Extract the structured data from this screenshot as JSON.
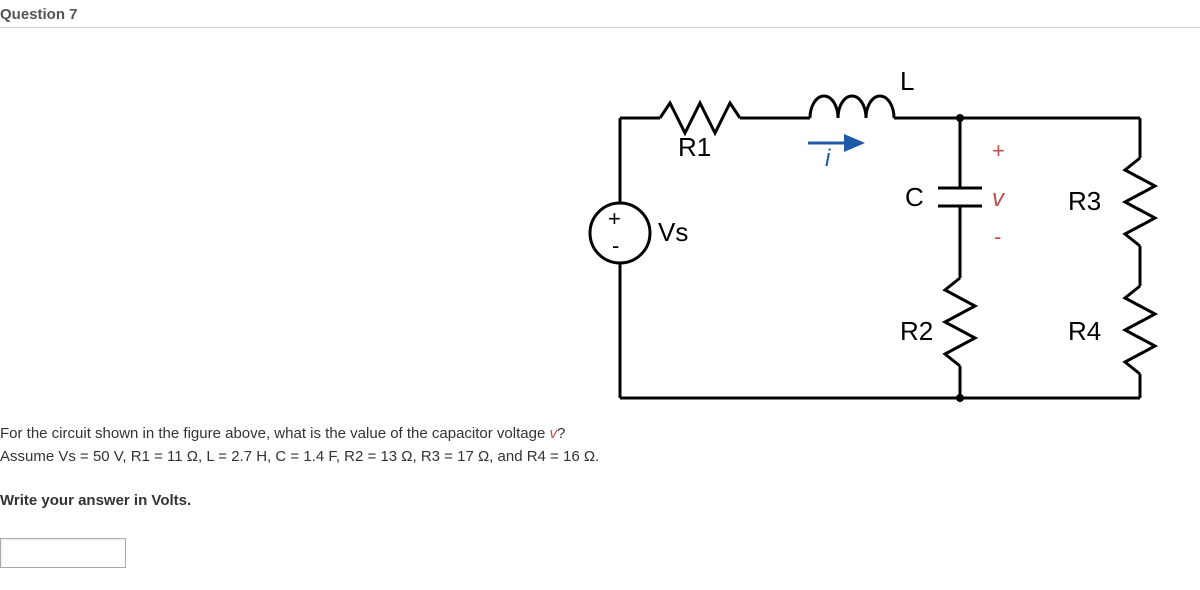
{
  "header": {
    "title": "Question 7"
  },
  "circuit": {
    "source": {
      "label": "Vs",
      "plus": "+",
      "minus": "-"
    },
    "r1": {
      "label": "R1"
    },
    "inductor": {
      "label": "L"
    },
    "current": {
      "label": "i"
    },
    "cap": {
      "label": "C"
    },
    "vcap": {
      "label": "v",
      "plus": "+",
      "minus": "-"
    },
    "r2": {
      "label": "R2"
    },
    "r3": {
      "label": "R3"
    },
    "r4": {
      "label": "R4"
    }
  },
  "prompt": {
    "line1a": "For the circuit shown in the figure above, what is the value of the capacitor voltage ",
    "line1b": "v",
    "line1c": "?",
    "line2": "Assume Vs = 50 V, R1 = 11 Ω, L = 2.7 H, C = 1.4 F, R2 = 13 Ω, R3 = 17 Ω, and R4 = 16 Ω.",
    "line3": "Write your answer in Volts."
  },
  "values": {
    "Vs_V": 50,
    "R1_ohm": 11,
    "L_H": 2.7,
    "C_F": 1.4,
    "R2_ohm": 13,
    "R3_ohm": 17,
    "R4_ohm": 16
  }
}
